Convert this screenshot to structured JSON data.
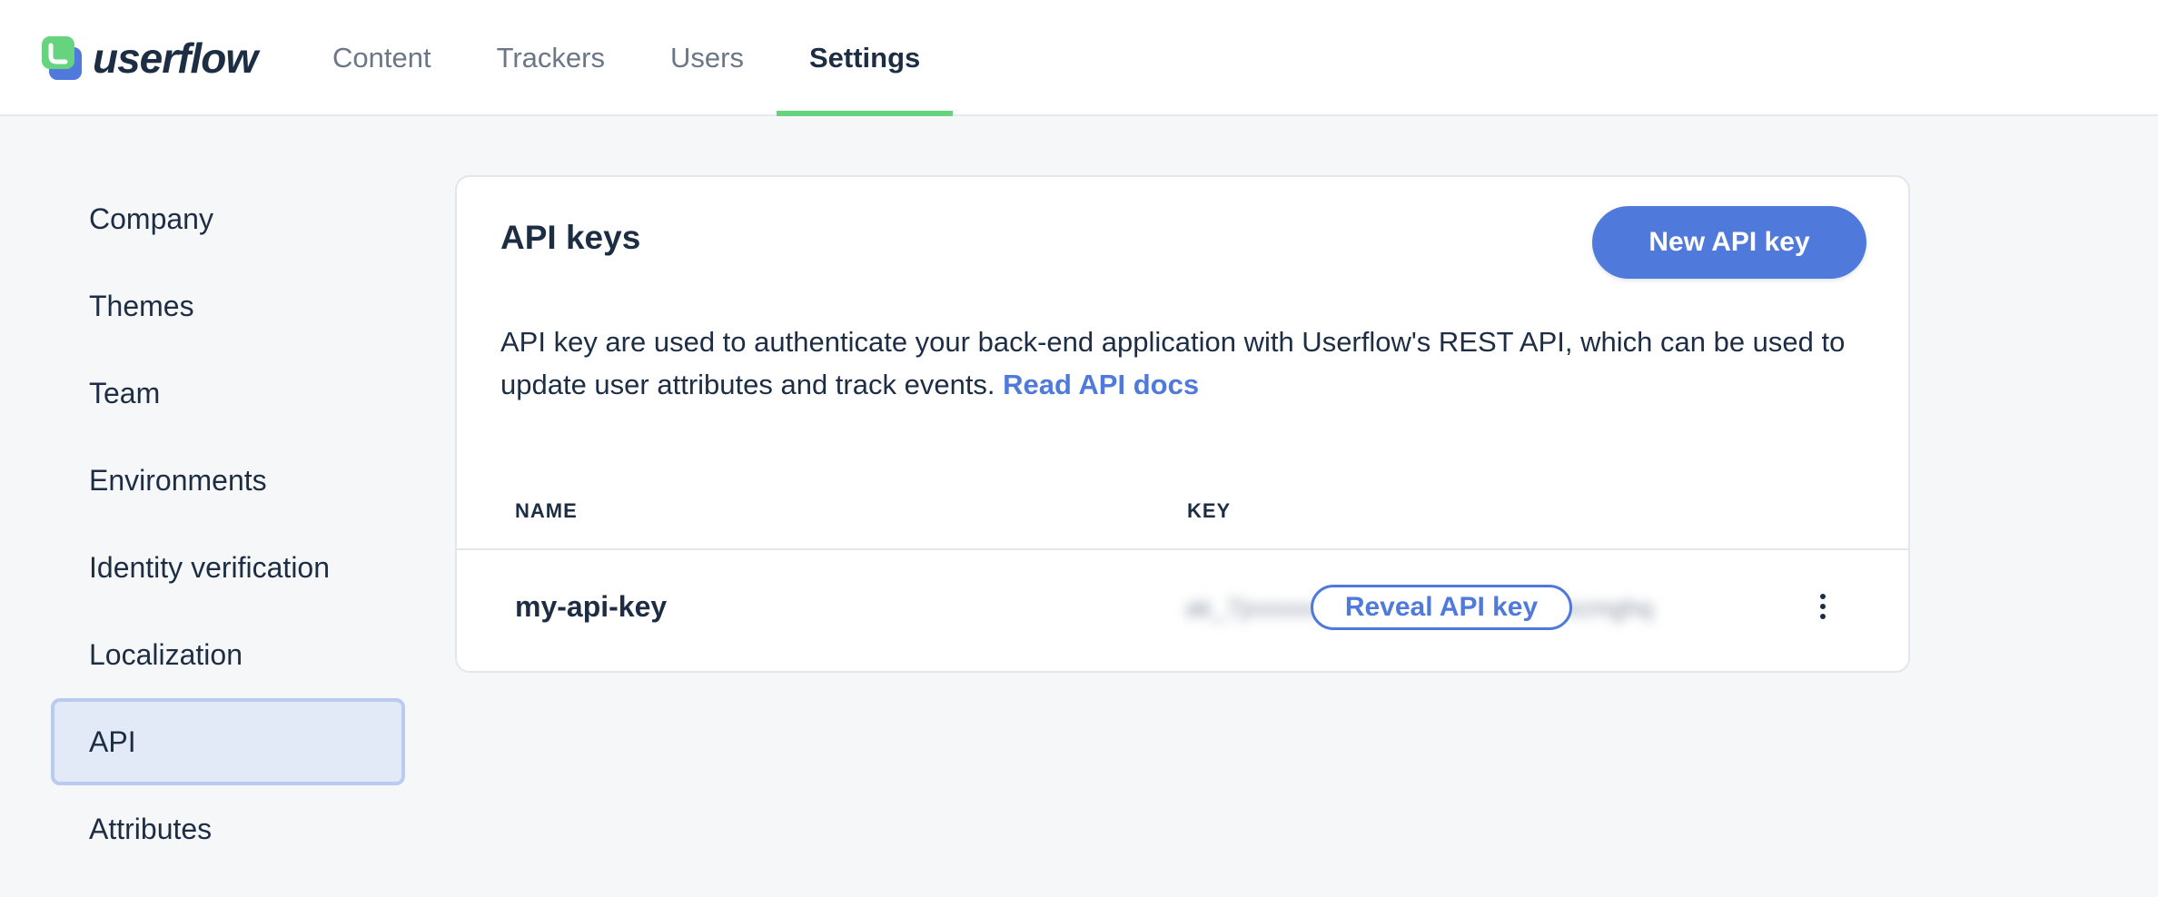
{
  "app": {
    "logo_text": "userflow",
    "brand_color": "#66d37e",
    "accent_color": "#4f79db"
  },
  "nav": {
    "tabs": [
      {
        "label": "Content"
      },
      {
        "label": "Trackers"
      },
      {
        "label": "Users"
      },
      {
        "label": "Settings",
        "active": true
      }
    ]
  },
  "sidebar": {
    "items": [
      {
        "label": "Company"
      },
      {
        "label": "Themes"
      },
      {
        "label": "Team"
      },
      {
        "label": "Environments"
      },
      {
        "label": "Identity verification"
      },
      {
        "label": "Localization"
      },
      {
        "label": "API",
        "active": true
      },
      {
        "label": "Attributes"
      }
    ]
  },
  "api_card": {
    "title": "API keys",
    "new_button_label": "New API key",
    "description": "API key are used to authenticate your back-end application with Userflow's REST API, which can be used to update user attributes and track events. ",
    "docs_link_label": "Read API docs",
    "table": {
      "headers": {
        "name": "NAME",
        "key": "KEY"
      },
      "rows": [
        {
          "name": "my-api-key",
          "key_masked": "ak_7jxxxxxxxxxxxxxxxxxxxxxxxxzxcmghq",
          "reveal_label": "Reveal API key",
          "more_icon": "more-vertical-icon"
        }
      ]
    }
  }
}
